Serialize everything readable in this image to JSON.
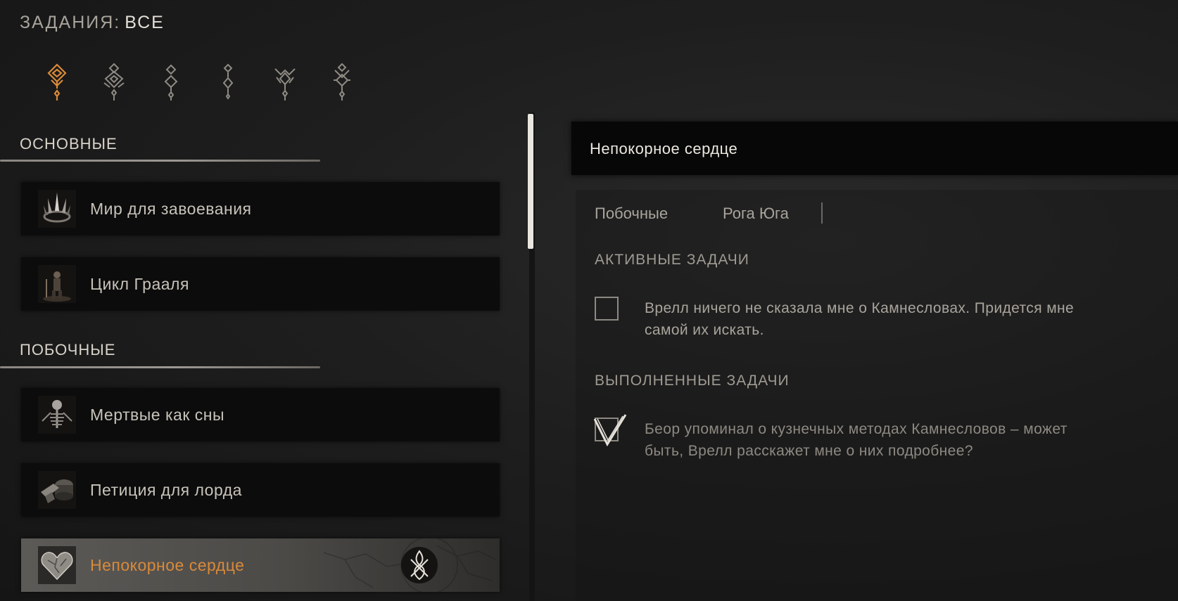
{
  "header": {
    "label": "ЗАДАНИЯ:",
    "value": "ВСЕ"
  },
  "filters": [
    {
      "icon": "filter-all-icon",
      "active": true
    },
    {
      "icon": "filter-main-icon",
      "active": false
    },
    {
      "icon": "filter-side-icon",
      "active": false
    },
    {
      "icon": "filter-minor-icon",
      "active": false
    },
    {
      "icon": "filter-trade-icon",
      "active": false
    },
    {
      "icon": "filter-faction-icon",
      "active": false
    }
  ],
  "sections": {
    "main": {
      "title": "ОСНОВНЫЕ",
      "items": [
        {
          "label": "Мир для завоевания",
          "icon": "crown-thumb-icon"
        },
        {
          "label": "Цикл Грааля",
          "icon": "figure-thumb-icon"
        }
      ]
    },
    "side": {
      "title": "ПОБОЧНЫЕ",
      "items": [
        {
          "label": "Мертвые как сны",
          "icon": "skeleton-thumb-icon"
        },
        {
          "label": "Петиция для лорда",
          "icon": "anvil-thumb-icon"
        },
        {
          "label": "Непокорное сердце",
          "icon": "stone-heart-thumb-icon"
        }
      ]
    }
  },
  "detail": {
    "title": "Непокорное сердце",
    "type": "Побочные",
    "location": "Рога Юга",
    "active_title": "АКТИВНЫЕ ЗАДАЧИ",
    "active_tasks": [
      "Врелл ничего не сказала мне о Камнесловах. Придется мне самой их искать."
    ],
    "done_title": "ВЫПОЛНЕННЫЕ ЗАДАЧИ",
    "done_tasks": [
      "Беор упоминал о кузнечных методах Камнесловов – может быть, Врелл расскажет мне о них подробнее?"
    ]
  },
  "colors": {
    "accent": "#d98a3a",
    "selected_text": "#d98a3a",
    "panel": "#0c0c0c",
    "selected_bg": "#5c5a57"
  }
}
